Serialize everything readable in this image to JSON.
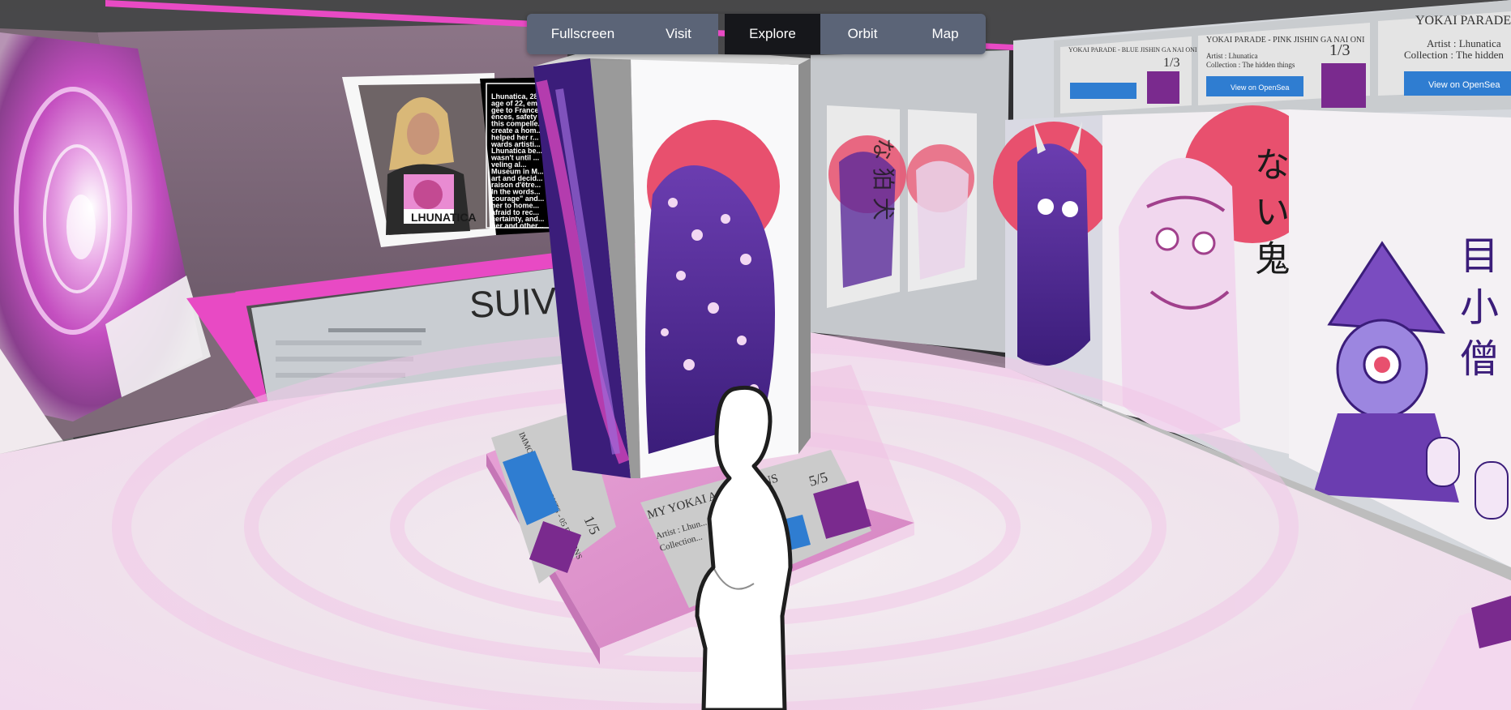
{
  "toolbar": {
    "fullscreen": "Fullscreen",
    "visit": "Visit",
    "explore": "Explore",
    "orbit": "Orbit",
    "map": "Map",
    "active_mode": "Explore"
  },
  "scene": {
    "artist_photo_caption": "LHUNATICA",
    "bio_lines": [
      "Lhunatica, 28, ...",
      "age of 22, emb...",
      "gee to France ...",
      "ences, safety ...",
      "this compelle...",
      "create a hom...",
      "helped her r...",
      "wards artisti...",
      "Lhunatica be...",
      "wasn't until ...",
      "veling al...",
      "Museum in M...",
      "art and decid...",
      "raison d'être...",
      "In the words...",
      "courage\" and...",
      "her to home...",
      "afraid to rec...",
      "certainty, and...",
      "her and other..."
    ],
    "back_wall_sign": "SUIV",
    "right_label_1_title": "YOKAI PARADE - BLUE JISHIN GA NAI ONI",
    "right_label_1_counter": "1/3",
    "right_label_2_title": "YOKAI PARADE - PINK JISHIN GA NAI ONI",
    "right_label_2_artist": "Artist : Lhunatica",
    "right_label_2_collection": "Collection : The hidden things",
    "right_label_2_counter": "1/3",
    "right_label_2_button": "View on OpenSea",
    "right_label_3_title": "YOKAI PARADE -",
    "right_label_3_artist": "Artist : Lhunatica",
    "right_label_3_collection": "Collection : The hidden",
    "right_label_3_button": "View on OpenSea",
    "pedestal_label_front_title": "MY YOKAI A... DEMONS",
    "pedestal_label_front_counter": "5/5",
    "pedestal_label_front_artist": "Artist : Lhun...",
    "pedestal_label_front_collection": "Collection...",
    "pedestal_label_side_title": "IMMORTAL THOUGHTS - 05 DEMONS",
    "pedestal_label_side_counter": "1/5",
    "poster_kanji_1": "な い 鬼",
    "poster_kanji_2": "目 小 僧",
    "poster_kanji_3": "な 狛 犬",
    "colors": {
      "toolbar_inactive": "#5b6477",
      "toolbar_active": "#16171b",
      "accent_pink": "#e84ac4",
      "sun_red": "#e8506e",
      "demon_purple": "#5a2a9a"
    }
  }
}
